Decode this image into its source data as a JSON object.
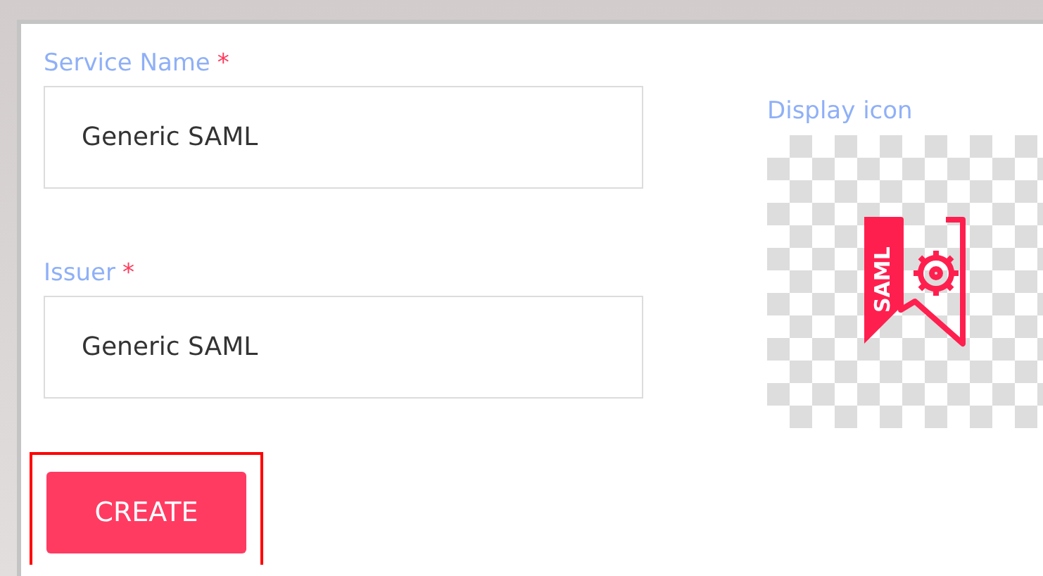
{
  "fields": [
    {
      "label": "Service Name",
      "required_mark": "*",
      "value": "Generic SAML"
    },
    {
      "label": "Issuer",
      "required_mark": "*",
      "value": "Generic SAML"
    }
  ],
  "display_icon": {
    "label": "Display icon",
    "badge_text": "SAML"
  },
  "create_button": {
    "label": "CREATE",
    "highlighted": true
  }
}
